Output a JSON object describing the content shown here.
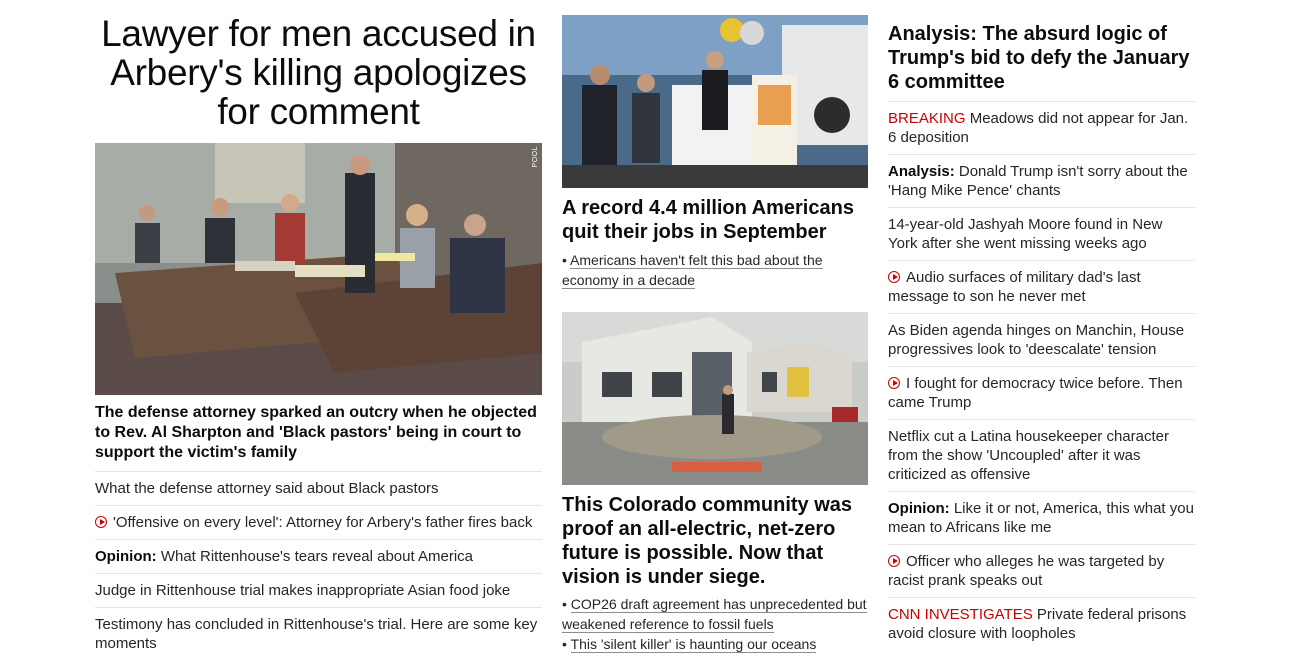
{
  "left": {
    "headline": "Lawyer for men accused in Arbery's killing apologizes for comment",
    "image_tag": "POOL",
    "summary": "The defense attorney sparked an outcry when he objected to Rev. Al Sharpton and 'Black pastors' being in court to support the victim's family",
    "items": [
      {
        "prefix": "",
        "text": "What the defense attorney said about Black pastors",
        "video": false
      },
      {
        "prefix": "",
        "text": "'Offensive on every level': Attorney for Arbery's father fires back",
        "video": true
      },
      {
        "prefix": "Opinion:",
        "text": " What Rittenhouse's tears reveal about America",
        "video": false
      },
      {
        "prefix": "",
        "text": "Judge in Rittenhouse trial makes inappropriate Asian food joke",
        "video": false
      },
      {
        "prefix": "",
        "text": "Testimony has concluded in Rittenhouse's trial. Here are some key moments",
        "video": false
      }
    ]
  },
  "middle": {
    "story1": {
      "headline": "A record 4.4 million Americans quit their jobs in September",
      "links": [
        "Americans haven't felt this bad about the economy in a decade"
      ]
    },
    "story2": {
      "headline": "This Colorado community was proof an all-electric, net-zero future is possible. Now that vision is under siege.",
      "links": [
        "COP26 draft agreement has unprecedented but weakened reference to fossil fuels",
        "This 'silent killer' is haunting our oceans"
      ]
    }
  },
  "right": {
    "headline": "Analysis: The absurd logic of Trump's bid to defy the January 6 committee",
    "items": [
      {
        "tag": "BREAKING",
        "prefix": "",
        "text": " Meadows did not appear for Jan. 6 deposition",
        "video": false
      },
      {
        "tag": "",
        "prefix": "Analysis:",
        "text": " Donald Trump isn't sorry about the 'Hang Mike Pence' chants",
        "video": false
      },
      {
        "tag": "",
        "prefix": "",
        "text": "14-year-old Jashyah Moore found in New York after she went missing weeks ago",
        "video": false
      },
      {
        "tag": "",
        "prefix": "",
        "text": "Audio surfaces of military dad's last message to son he never met",
        "video": true
      },
      {
        "tag": "",
        "prefix": "",
        "text": "As Biden agenda hinges on Manchin, House progressives look to 'deescalate' tension",
        "video": false
      },
      {
        "tag": "",
        "prefix": "",
        "text": "I fought for democracy twice before. Then came Trump",
        "video": true
      },
      {
        "tag": "",
        "prefix": "",
        "text": "Netflix cut a Latina housekeeper character from the show 'Uncoupled' after it was criticized as offensive",
        "video": false
      },
      {
        "tag": "",
        "prefix": "Opinion:",
        "text": " Like it or not, America, this what you mean to Africans like me",
        "video": false
      },
      {
        "tag": "",
        "prefix": "",
        "text": "Officer who alleges he was targeted by racist prank speaks out",
        "video": true
      },
      {
        "tag": "CNN INVESTIGATES",
        "prefix": "",
        "text": " Private federal prisons avoid closure with loopholes",
        "video": false
      }
    ]
  },
  "colors": {
    "accent_red": "#cc0000",
    "text": "#262626",
    "divider": "#e6e6e6"
  }
}
